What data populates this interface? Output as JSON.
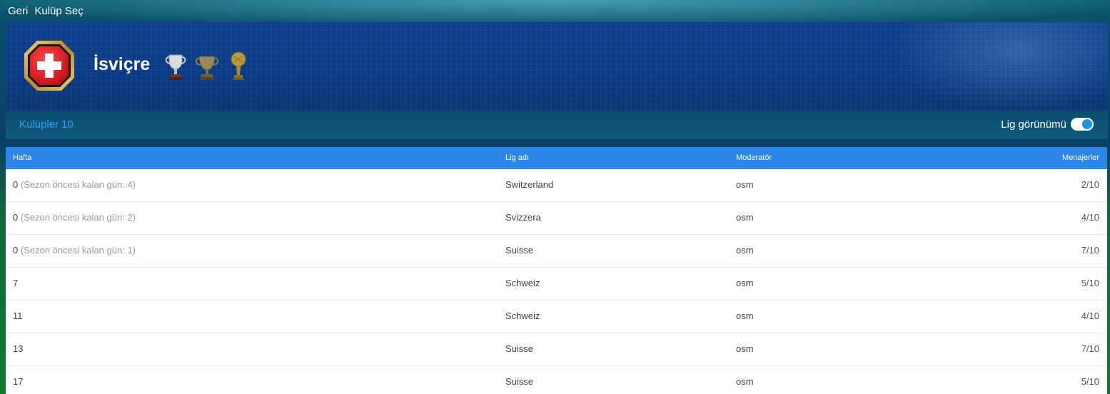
{
  "topbar": {
    "back_label": "Geri",
    "select_club_label": "Kulüp Seç"
  },
  "hero": {
    "country_name": "İsviçre",
    "badge_icon": "swiss-cross-badge-icon",
    "trophy_icons": [
      "silver-trophy-icon",
      "bronze-cup-icon",
      "gold-ball-trophy-icon"
    ]
  },
  "subbar": {
    "clubs_label": "Kulüpler",
    "clubs_count": "10",
    "league_view_label": "Lig görünümü",
    "league_view_on": true
  },
  "table": {
    "headers": {
      "week": "Hafta",
      "league_name": "Lig adı",
      "moderator": "Moderatör",
      "managers": "Menajerler"
    },
    "rows": [
      {
        "week": "0",
        "note": "(Sezon öncesi kalan gün: 4)",
        "league": "Switzerland",
        "moderator": "osm",
        "managers": "2/10"
      },
      {
        "week": "0",
        "note": "(Sezon öncesi kalan gün: 2)",
        "league": "Svizzera",
        "moderator": "osm",
        "managers": "4/10"
      },
      {
        "week": "0",
        "note": "(Sezon öncesi kalan gün: 1)",
        "league": "Suisse",
        "moderator": "osm",
        "managers": "7/10"
      },
      {
        "week": "7",
        "note": "",
        "league": "Schweiz",
        "moderator": "osm",
        "managers": "5/10"
      },
      {
        "week": "11",
        "note": "",
        "league": "Schweiz",
        "moderator": "osm",
        "managers": "4/10"
      },
      {
        "week": "13",
        "note": "",
        "league": "Suisse",
        "moderator": "osm",
        "managers": "7/10"
      },
      {
        "week": "17",
        "note": "",
        "league": "Suisse",
        "moderator": "osm",
        "managers": "5/10"
      }
    ]
  },
  "colors": {
    "header_blue": "#2a87e6",
    "link_blue": "#2aa3f0",
    "badge_red": "#e5202a",
    "badge_gold": "#c9a24a"
  }
}
